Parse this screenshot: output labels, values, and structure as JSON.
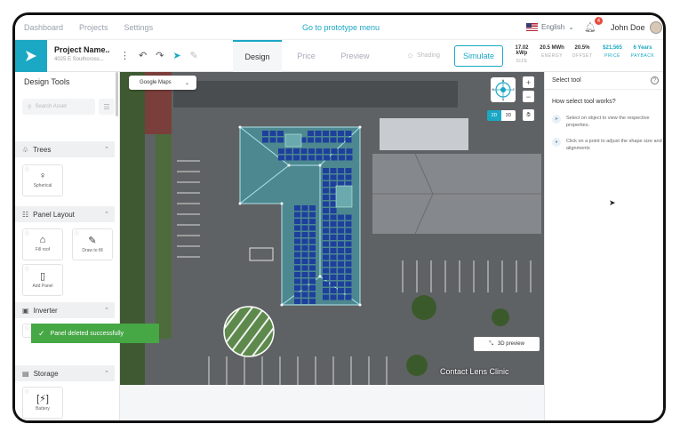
{
  "topnav": {
    "links": [
      "Dashboard",
      "Projects",
      "Settings"
    ],
    "prototype_link": "Go to prototype menu",
    "language": "English",
    "notification_count": "4",
    "user_name": "John Doe"
  },
  "toolbar": {
    "project_name": "Project Name..",
    "project_address": "4025 E Southcross...",
    "tabs": [
      "Design",
      "Price",
      "Preview"
    ],
    "active_tab": "Design",
    "shading_label": "Shading",
    "simulate_label": "Simulate",
    "stats": [
      {
        "value": "17.02 kWp",
        "label": "SIZE"
      },
      {
        "value": "20.5 MWh",
        "label": "ENERGY"
      },
      {
        "value": "20.5%",
        "label": "OFFSET"
      },
      {
        "value": "$21,565",
        "label": "PRICE"
      },
      {
        "value": "6 Years",
        "label": "PAYBACK"
      }
    ]
  },
  "sidebar": {
    "title": "Design Tools",
    "search_placeholder": "Search Asset",
    "sections": [
      {
        "name": "Trees",
        "items": [
          "Spherical"
        ]
      },
      {
        "name": "Panel Layout",
        "items": [
          "Fill roof",
          "Draw to fill",
          "Add Panel"
        ]
      },
      {
        "name": "Inverter",
        "items": []
      },
      {
        "name": "Storage",
        "items": [
          "Battery"
        ]
      }
    ]
  },
  "toast": {
    "message": "Panel deleted successfully"
  },
  "map": {
    "source_label": "Google Maps",
    "view_2d": "2D",
    "view_3d": "3D",
    "preview_button": "3D preview",
    "place_label": "Contact Lens Clinic",
    "compass_n": "N",
    "compass_s": "S",
    "compass_e": "E",
    "compass_w": "W"
  },
  "right_panel": {
    "title": "Select tool",
    "question": "How select tool works?",
    "steps": [
      "Select on object to view the respective properties.",
      "Click on a point to adjust the shape size and alignments"
    ]
  },
  "colors": {
    "accent": "#1aa8c4",
    "toast": "#46a745",
    "roof": "#4a8f98",
    "panel": "#1e3f9c"
  }
}
